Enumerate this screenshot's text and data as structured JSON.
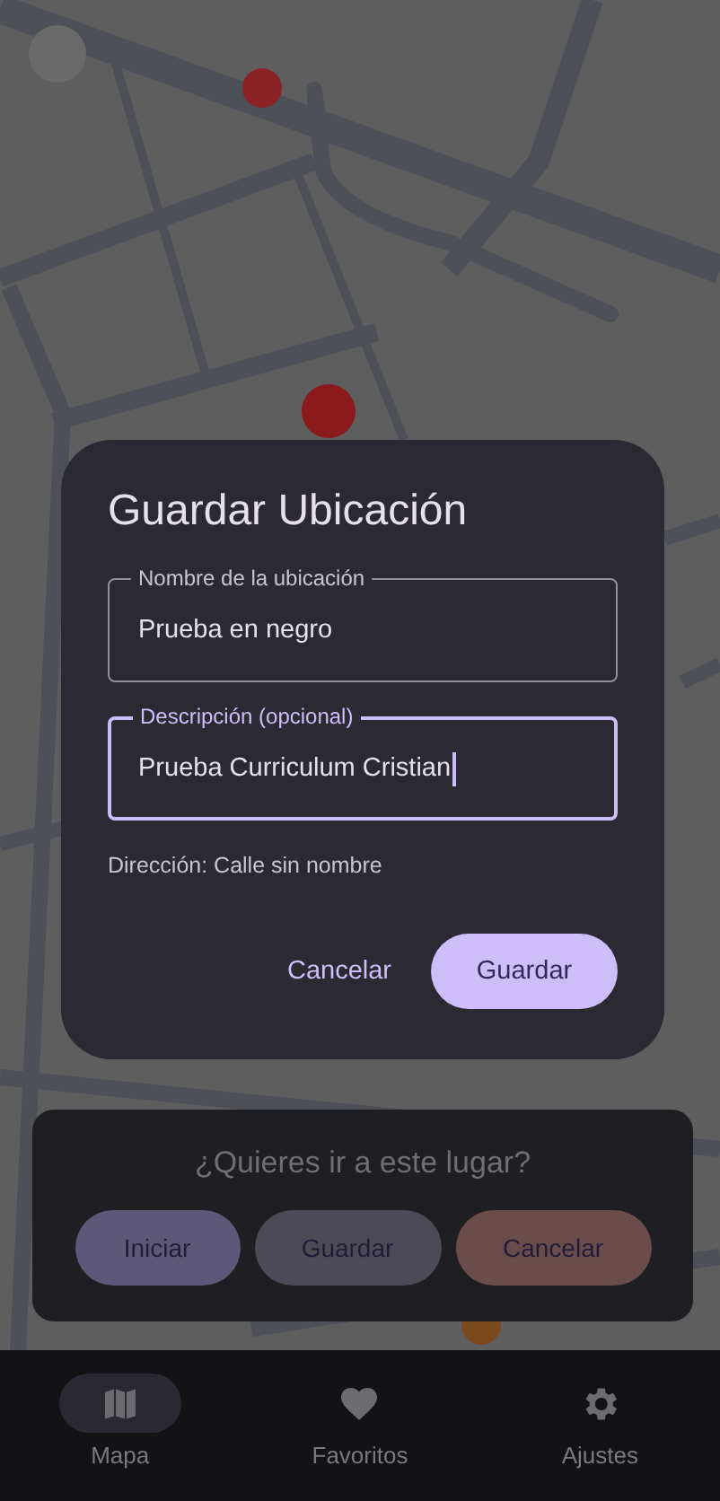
{
  "dialog": {
    "title": "Guardar Ubicación",
    "fields": [
      {
        "label": "Nombre de la ubicación",
        "value": "Prueba en negro",
        "focused": false
      },
      {
        "label": "Descripción (opcional)",
        "value": "Prueba Curriculum Cristian",
        "focused": true
      }
    ],
    "address": "Dirección: Calle sin nombre",
    "buttons": [
      {
        "label": "Cancelar",
        "kind": "text"
      },
      {
        "label": "Guardar",
        "kind": "filled"
      }
    ]
  },
  "prompt": {
    "question": "¿Quieres ir a este lugar?",
    "buttons": [
      {
        "label": "Iniciar",
        "kind": "start"
      },
      {
        "label": "Guardar",
        "kind": "save"
      },
      {
        "label": "Cancelar",
        "kind": "cancel"
      }
    ]
  },
  "nav": [
    {
      "label": "Mapa",
      "kind": "map",
      "selected": true
    },
    {
      "label": "Favoritos",
      "kind": "heart",
      "selected": false
    },
    {
      "label": "Ajustes",
      "kind": "gear",
      "selected": false
    }
  ]
}
